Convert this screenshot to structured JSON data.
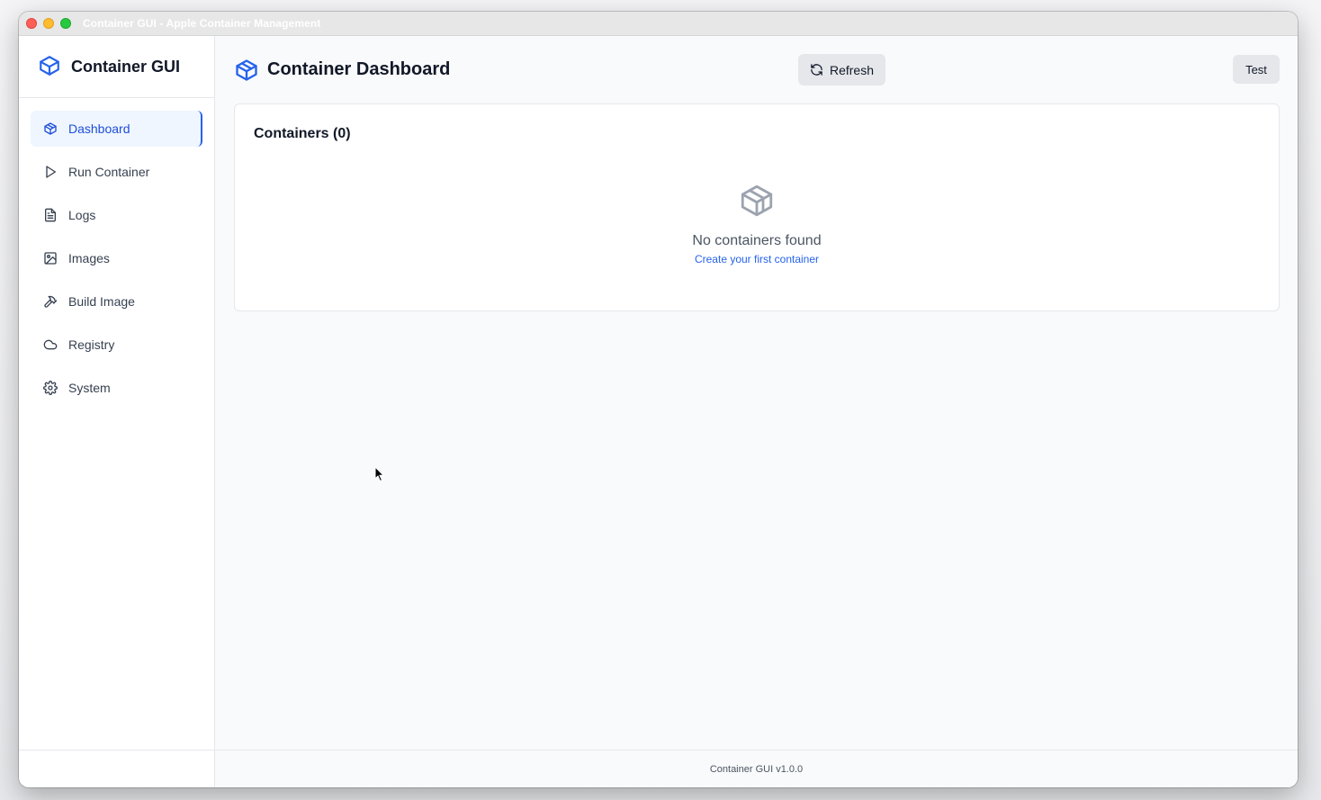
{
  "window": {
    "title": "Container GUI - Apple Container Management"
  },
  "sidebar": {
    "brand": "Container GUI",
    "items": [
      {
        "label": "Dashboard",
        "icon": "package-icon",
        "active": true
      },
      {
        "label": "Run Container",
        "icon": "play-icon",
        "active": false
      },
      {
        "label": "Logs",
        "icon": "file-text-icon",
        "active": false
      },
      {
        "label": "Images",
        "icon": "image-icon",
        "active": false
      },
      {
        "label": "Build Image",
        "icon": "hammer-icon",
        "active": false
      },
      {
        "label": "Registry",
        "icon": "cloud-icon",
        "active": false
      },
      {
        "label": "System",
        "icon": "gear-icon",
        "active": false
      }
    ]
  },
  "header": {
    "title": "Container Dashboard",
    "refresh_label": "Refresh",
    "test_label": "Test"
  },
  "containers": {
    "title": "Containers (0)",
    "empty_text": "No containers found",
    "empty_link": "Create your first container"
  },
  "footer": {
    "version": "Container GUI v1.0.0"
  },
  "colors": {
    "accent": "#2563eb",
    "active_bg": "#eff6ff",
    "sidebar_bg": "#ffffff",
    "main_bg": "#f9fafb"
  }
}
